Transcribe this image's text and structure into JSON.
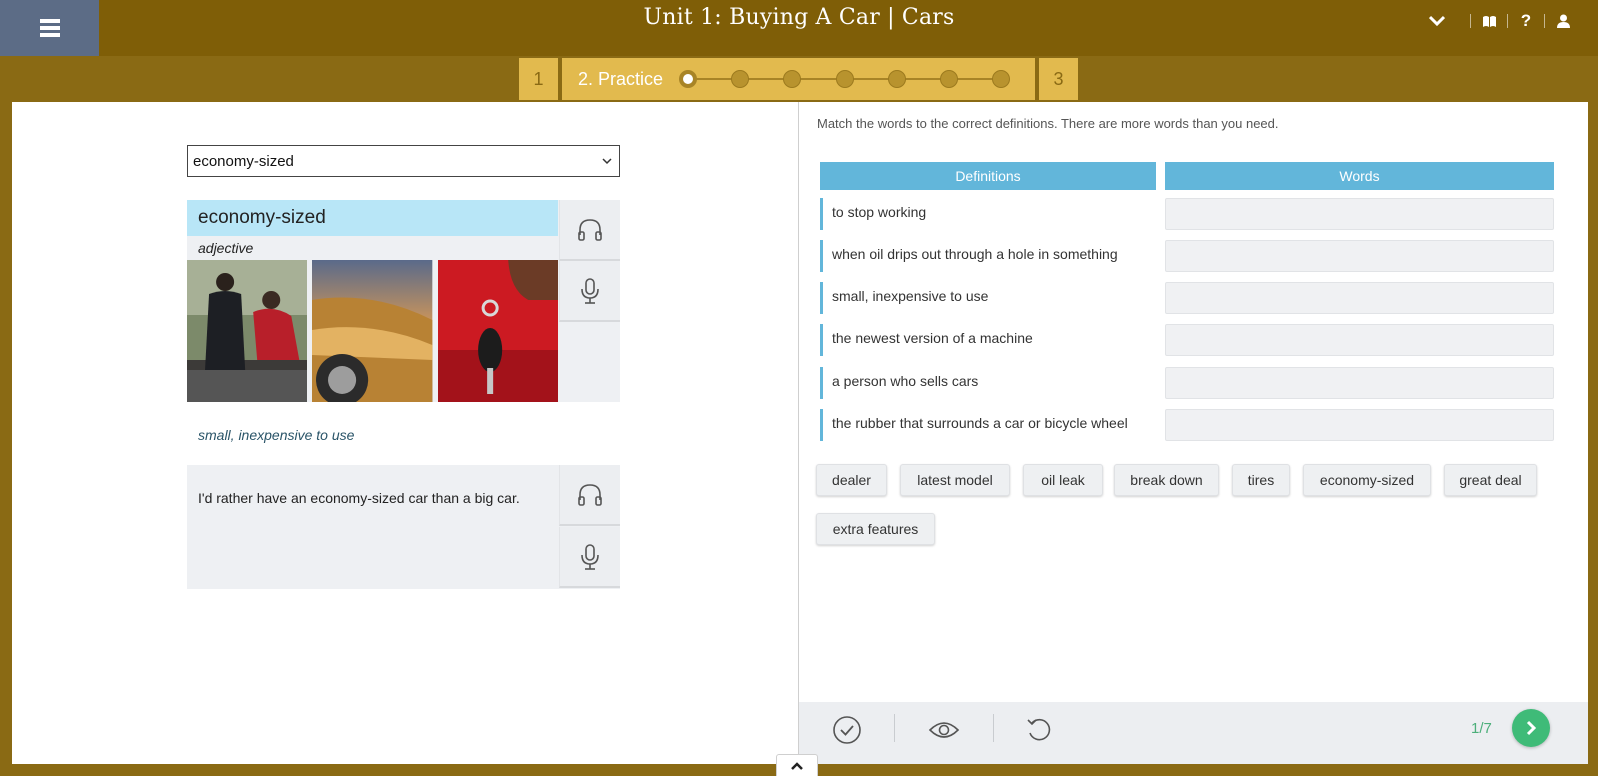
{
  "header": {
    "title": "Unit 1: Buying A Car | Cars",
    "icons": [
      "menu-icon",
      "chevron-down-icon",
      "book-icon",
      "help-icon",
      "user-icon"
    ]
  },
  "steps": {
    "step1": "1",
    "step2": "2. Practice",
    "step3": "3",
    "dots_total": 7,
    "dot_active": 1
  },
  "left": {
    "select_value": "economy-sized",
    "word": "economy-sized",
    "part_of_speech": "adjective",
    "definition": "small, inexpensive to use",
    "example": "I'd rather have an economy-sized car than a big car."
  },
  "right": {
    "instructions": "Match the words to the correct definitions. There are more words than you need.",
    "col_definitions": "Definitions",
    "col_words": "Words",
    "definitions": [
      "to stop working",
      "when oil drips out through a hole in something",
      "small, inexpensive to use",
      "the newest version of a machine",
      "a person who sells cars",
      "the rubber that surrounds a car or bicycle wheel"
    ],
    "words": [
      "dealer",
      "latest model",
      "oil leak",
      "break down",
      "tires",
      "economy-sized",
      "great deal",
      "extra features"
    ]
  },
  "footer": {
    "page": "1/7"
  },
  "colors": {
    "header_bg": "#7f5e07",
    "step_bg": "#e2ba4e",
    "table_header": "#62b6da",
    "word_highlight": "#b8e6f7",
    "next_button": "#3fbb78"
  }
}
